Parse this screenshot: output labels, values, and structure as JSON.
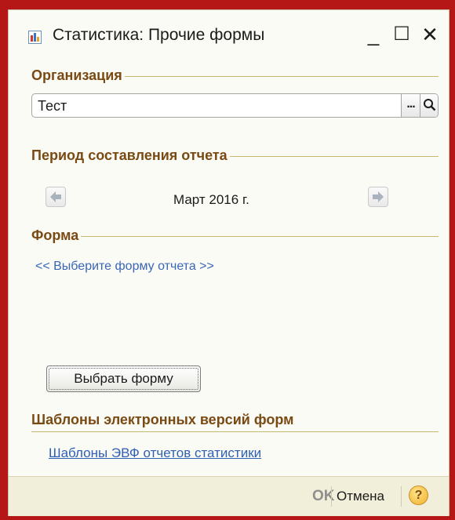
{
  "window": {
    "title": "Статистика: Прочие формы",
    "minimize_glyph": "_",
    "maximize_glyph": "☐",
    "close_glyph": "✕"
  },
  "organization": {
    "section_title": "Организация",
    "value": "Тест",
    "select_glyph": "...",
    "search_icon": "magnifier-icon"
  },
  "period": {
    "section_title": "Период составления отчета",
    "value": "Март 2016 г.",
    "prev_icon": "arrow-left-icon",
    "next_icon": "arrow-right-icon"
  },
  "form": {
    "section_title": "Форма",
    "hint": "<< Выберите форму отчета >>",
    "select_button": "Выбрать форму"
  },
  "templates": {
    "section_title": "Шаблоны электронных версий форм",
    "link": "Шаблоны ЭВФ отчетов статистики"
  },
  "footer": {
    "ok": "OK",
    "cancel": "Отмена",
    "help": "?"
  },
  "colors": {
    "section_title": "#7a4a14",
    "link": "#2f5fb3",
    "frame": "#b51616"
  }
}
